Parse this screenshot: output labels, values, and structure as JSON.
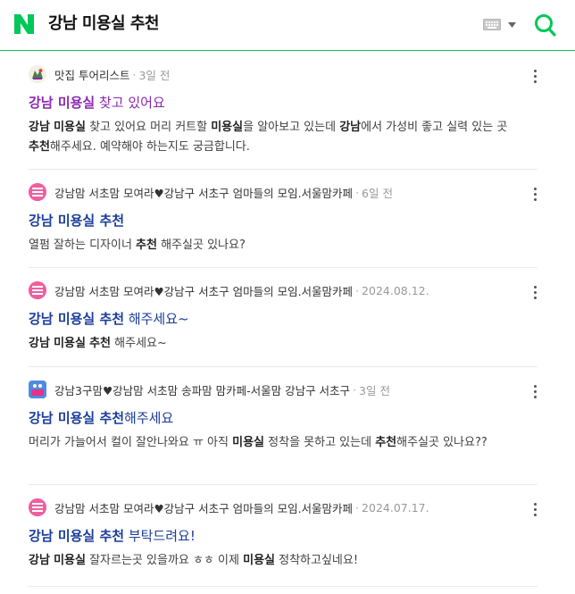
{
  "search": {
    "query": "강남 미용실 추천"
  },
  "results": [
    {
      "source": "맛집 투어리스트",
      "date": "3일 전",
      "title": [
        {
          "t": "강남 미용실",
          "b": true
        },
        {
          "t": " 찾고 있어요",
          "b": false
        }
      ],
      "desc": [
        {
          "t": "강남",
          "b": true
        },
        {
          "t": " ",
          "b": false
        },
        {
          "t": "미용실",
          "b": true
        },
        {
          "t": " 찾고 있어요 머리 커트할 ",
          "b": false
        },
        {
          "t": "미용실",
          "b": true
        },
        {
          "t": "을 알아보고 있는데 ",
          "b": false
        },
        {
          "t": "강남",
          "b": true
        },
        {
          "t": "에서 가성비 좋고 실력 있는 곳 ",
          "b": false
        },
        {
          "t": "추천",
          "b": true
        },
        {
          "t": "해주세요. 예약해야 하는지도 궁금합니다.",
          "b": false
        }
      ],
      "visited": true
    },
    {
      "source": "강남맘 서초맘 모여라♥강남구 서초구 엄마들의 모임.서울맘카페",
      "date": "6일 전",
      "title": [
        {
          "t": "강남 미용실 추천",
          "b": true
        }
      ],
      "desc": [
        {
          "t": "열펌 잘하는 디자이너 ",
          "b": false
        },
        {
          "t": "추천",
          "b": true
        },
        {
          "t": " 해주실곳 있나요?",
          "b": false
        }
      ],
      "visited": false
    },
    {
      "source": "강남맘 서초맘 모여라♥강남구 서초구 엄마들의 모임.서울맘카페",
      "date": "2024.08.12.",
      "title": [
        {
          "t": "강남 미용실 추천",
          "b": true
        },
        {
          "t": " 해주세요~",
          "b": false
        }
      ],
      "desc": [
        {
          "t": "강남",
          "b": true
        },
        {
          "t": " ",
          "b": false
        },
        {
          "t": "미용실",
          "b": true
        },
        {
          "t": " ",
          "b": false
        },
        {
          "t": "추천",
          "b": true
        },
        {
          "t": " 해주세요~",
          "b": false
        }
      ],
      "visited": false
    },
    {
      "source": "강남3구맘♥강남맘 서초맘 송파맘 맘카페-서울맘 강남구 서초구",
      "date": "3일 전",
      "title": [
        {
          "t": "강남 미용실 추천",
          "b": true
        },
        {
          "t": "해주세요",
          "b": false
        }
      ],
      "desc": [
        {
          "t": "머리가 가늘어서 컬이 잘안나와요 ㅠ 아직 ",
          "b": false
        },
        {
          "t": "미용실",
          "b": true
        },
        {
          "t": " 정착을 못하고 있는데 ",
          "b": false
        },
        {
          "t": "추천",
          "b": true
        },
        {
          "t": "해주실곳 있나요??",
          "b": false
        }
      ],
      "visited": false
    },
    {
      "source": "강남맘 서초맘 모여라♥강남구 서초구 엄마들의 모임.서울맘카페",
      "date": "2024.07.17.",
      "title": [
        {
          "t": "강남 미용실 추천",
          "b": true
        },
        {
          "t": " 부탁드려요!",
          "b": false
        }
      ],
      "desc": [
        {
          "t": "강남",
          "b": true
        },
        {
          "t": " ",
          "b": false
        },
        {
          "t": "미용실",
          "b": true
        },
        {
          "t": " 잘자르는곳 있을까요 ㅎㅎ 이제 ",
          "b": false
        },
        {
          "t": "미용실",
          "b": true
        },
        {
          "t": " 정착하고싶네요!",
          "b": false
        }
      ],
      "visited": false
    }
  ],
  "avatar_labels": {
    "cafe3": "강남3구맘"
  },
  "colors": {
    "brand": "#03c75a",
    "title_link": "#1a3d99",
    "title_visited": "#8b28b0"
  }
}
